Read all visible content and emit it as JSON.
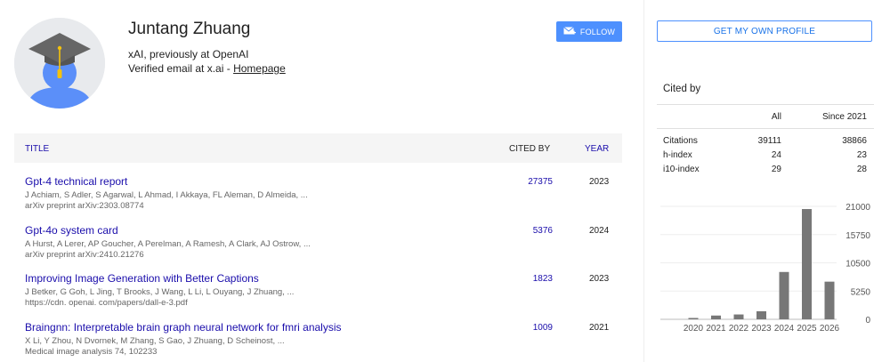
{
  "profile": {
    "name": "Juntang Zhuang",
    "affiliation": "xAI, previously at OpenAI",
    "email_prefix": "Verified email at x.ai - ",
    "homepage_label": "Homepage",
    "follow_label": "FOLLOW",
    "get_profile_label": "GET MY OWN PROFILE"
  },
  "table": {
    "headers": {
      "title": "TITLE",
      "cited_by": "CITED BY",
      "year": "YEAR"
    },
    "rows": [
      {
        "title": "Gpt-4 technical report",
        "authors": "J Achiam, S Adler, S Agarwal, L Ahmad, I Akkaya, FL Aleman, D Almeida, ...",
        "venue": "arXiv preprint arXiv:2303.08774",
        "cited_by": "27375",
        "year": "2023"
      },
      {
        "title": "Gpt-4o system card",
        "authors": "A Hurst, A Lerer, AP Goucher, A Perelman, A Ramesh, A Clark, AJ Ostrow, ...",
        "venue": "arXiv preprint arXiv:2410.21276",
        "cited_by": "5376",
        "year": "2024"
      },
      {
        "title": "Improving Image Generation with Better Captions",
        "authors": "J Betker, G Goh, L Jing, T Brooks, J Wang, L Li, L Ouyang, J Zhuang, ...",
        "venue": "https://cdn. openai. com/papers/dall-e-3.pdf",
        "cited_by": "1823",
        "year": "2023"
      },
      {
        "title": "Braingnn: Interpretable brain graph neural network for fmri analysis",
        "authors": "X Li, Y Zhou, N Dvornek, M Zhang, S Gao, J Zhuang, D Scheinost, ...",
        "venue": "Medical image analysis 74, 102233",
        "cited_by": "1009",
        "year": "2021"
      }
    ]
  },
  "cited_by": {
    "title": "Cited by",
    "col_all": "All",
    "col_since": "Since 2021",
    "rows": [
      {
        "label": "Citations",
        "all": "39111",
        "since": "38866"
      },
      {
        "label": "h-index",
        "all": "24",
        "since": "23"
      },
      {
        "label": "i10-index",
        "all": "29",
        "since": "28"
      }
    ]
  },
  "chart_data": {
    "type": "bar",
    "categories": [
      "2020",
      "2021",
      "2022",
      "2023",
      "2024",
      "2025",
      "2026"
    ],
    "values": [
      250,
      700,
      900,
      1500,
      8800,
      20500,
      7000
    ],
    "ylim": [
      0,
      21000
    ],
    "yticks": [
      0,
      5250,
      10500,
      15750,
      21000
    ],
    "bar_color": "#777777"
  },
  "colors": {
    "accent_button": "#4d90fe",
    "link": "#1a0dab",
    "header_bg": "#f5f5f5"
  }
}
